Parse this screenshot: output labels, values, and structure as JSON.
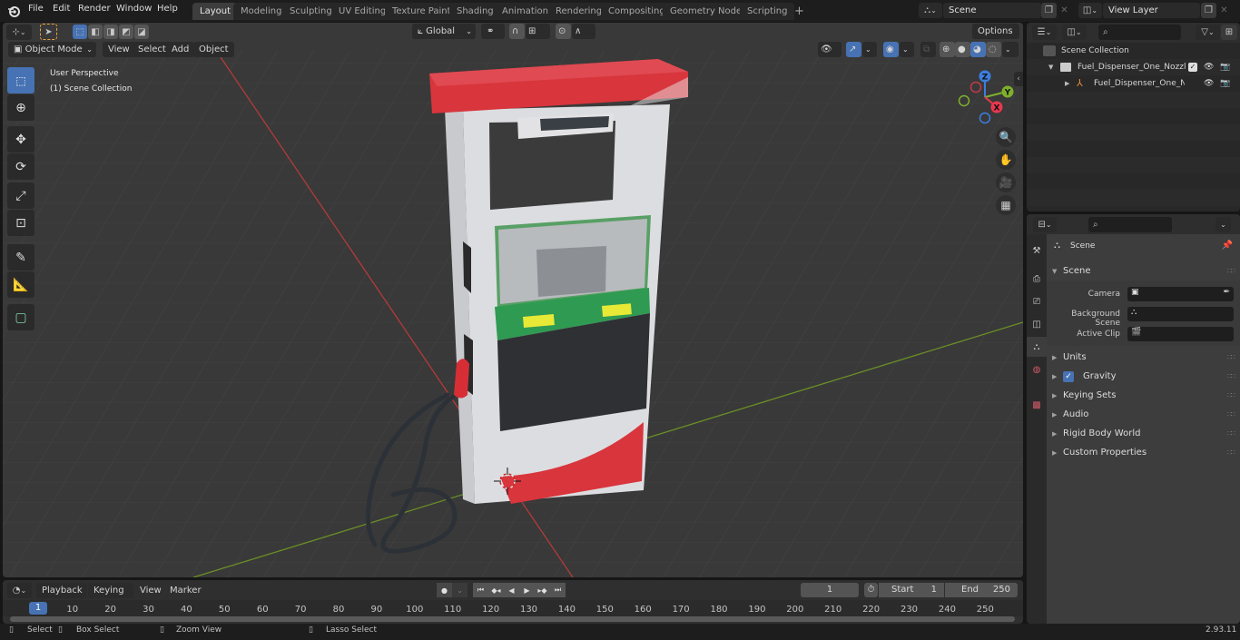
{
  "topbar": {
    "menus": [
      "File",
      "Edit",
      "Render",
      "Window",
      "Help"
    ],
    "workspaces": [
      "Layout",
      "Modeling",
      "Sculpting",
      "UV Editing",
      "Texture Paint",
      "Shading",
      "Animation",
      "Rendering",
      "Compositing",
      "Geometry Nodes",
      "Scripting"
    ],
    "active_workspace": "Layout",
    "add_workspace": "+",
    "scene_name": "Scene",
    "view_layer_name": "View Layer"
  },
  "viewport": {
    "mode": "Object Mode",
    "menus": [
      "View",
      "Select",
      "Add",
      "Object"
    ],
    "transform_orientation": "Global",
    "options_label": "Options",
    "overlay_line1": "User Perspective",
    "overlay_line2": "(1) Scene Collection",
    "gizmo_axes": {
      "x": "X",
      "y": "Y",
      "z": "Z"
    },
    "tools": [
      "select-box",
      "cursor",
      "move",
      "rotate",
      "scale",
      "transform",
      "annotate",
      "measure",
      "add-cube"
    ],
    "active_tool": "select-box",
    "object": "Fuel dispenser with red canopy, white body, green panel and red nozzle hose"
  },
  "outliner": {
    "root": "Scene Collection",
    "items": [
      {
        "name": "Fuel_Dispenser_One_Nozzle_(",
        "type": "collection",
        "expanded": true,
        "checked": true
      },
      {
        "name": "Fuel_Dispenser_One_Noz",
        "type": "empty",
        "expanded": false
      }
    ]
  },
  "properties": {
    "context": "Scene",
    "section": "Scene",
    "fields": [
      {
        "label": "Camera",
        "value": ""
      },
      {
        "label": "Background Scene",
        "value": ""
      },
      {
        "label": "Active Clip",
        "value": ""
      }
    ],
    "panels": [
      {
        "label": "Units",
        "checkbox": false
      },
      {
        "label": "Gravity",
        "checkbox": true,
        "checked": true
      },
      {
        "label": "Keying Sets",
        "checkbox": false
      },
      {
        "label": "Audio",
        "checkbox": false
      },
      {
        "label": "Rigid Body World",
        "checkbox": false
      },
      {
        "label": "Custom Properties",
        "checkbox": false
      }
    ],
    "tabs": [
      "tool",
      "render",
      "output",
      "view-layer",
      "scene",
      "world",
      "texture"
    ],
    "active_tab": "scene"
  },
  "timeline": {
    "menus": [
      "Playback",
      "Keying",
      "View",
      "Marker"
    ],
    "current_frame": "1",
    "start_label": "Start",
    "start": "1",
    "end_label": "End",
    "end": "250",
    "ticks": [
      "10",
      "20",
      "30",
      "40",
      "50",
      "60",
      "70",
      "80",
      "90",
      "100",
      "110",
      "120",
      "130",
      "140",
      "150",
      "160",
      "170",
      "180",
      "190",
      "200",
      "210",
      "220",
      "230",
      "240",
      "250"
    ],
    "playhead": "1"
  },
  "statusbar": {
    "hints": [
      "Select",
      "Box Select",
      "Zoom View",
      "Lasso Select"
    ],
    "version": "2.93.11"
  }
}
